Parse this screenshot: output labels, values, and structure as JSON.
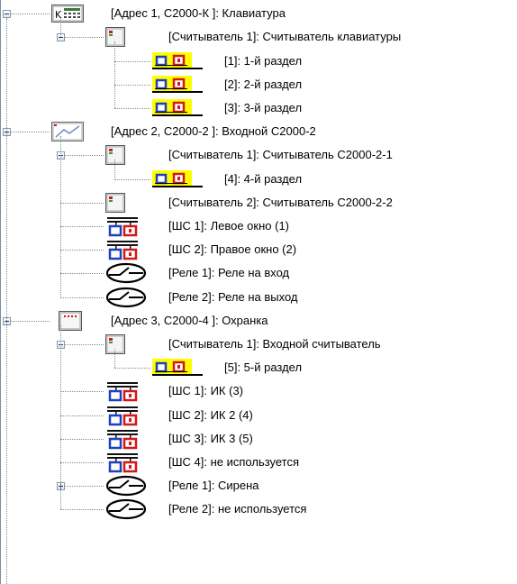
{
  "tree": [
    {
      "id": "n1",
      "label": "[Адрес 1, С2000-К ]: Клавиатура",
      "icon": "keypad-icon",
      "expander": "minus",
      "children": [
        {
          "id": "n1r1",
          "label": "[Считыватель 1]: Считыватель клавиатуры",
          "icon": "reader-icon",
          "expander": "minus",
          "children": [
            {
              "id": "n1r1a",
              "label": "[1]: 1-й раздел",
              "icon": "partition-icon"
            },
            {
              "id": "n1r1b",
              "label": "[2]: 2-й раздел",
              "icon": "partition-icon"
            },
            {
              "id": "n1r1c",
              "label": "[3]: 3-й раздел",
              "icon": "partition-icon"
            }
          ]
        }
      ]
    },
    {
      "id": "n2",
      "label": "[Адрес 2, С2000-2 ]: Входной С2000-2",
      "icon": "c2000-2-device-icon",
      "expander": "minus",
      "children": [
        {
          "id": "n2r1",
          "label": "[Считыватель 1]: Считыватель С2000-2-1",
          "icon": "reader-icon",
          "expander": "minus",
          "children": [
            {
              "id": "n2r1a",
              "label": "[4]: 4-й раздел",
              "icon": "partition-icon"
            }
          ]
        },
        {
          "id": "n2r2",
          "label": "[Считыватель 2]: Считыватель С2000-2-2",
          "icon": "reader-icon"
        },
        {
          "id": "n2z1",
          "label": "[ШС 1]: Левое окно (1)",
          "icon": "zone-icon"
        },
        {
          "id": "n2z2",
          "label": "[ШС 2]: Правое окно (2)",
          "icon": "zone-icon"
        },
        {
          "id": "n2p1",
          "label": "[Реле 1]: Реле на вход",
          "icon": "relay-icon"
        },
        {
          "id": "n2p2",
          "label": "[Реле 2]: Реле на выход",
          "icon": "relay-icon"
        }
      ]
    },
    {
      "id": "n3",
      "label": "[Адрес 3, С2000-4 ]: Охранка",
      "icon": "c2000-4-device-icon",
      "expander": "minus",
      "children": [
        {
          "id": "n3r1",
          "label": "[Считыватель 1]: Входной считыватель",
          "icon": "reader-icon",
          "expander": "minus",
          "children": [
            {
              "id": "n3r1a",
              "label": "[5]: 5-й раздел",
              "icon": "partition-icon"
            }
          ]
        },
        {
          "id": "n3z1",
          "label": "[ШС 1]: ИК (3)",
          "icon": "zone-icon"
        },
        {
          "id": "n3z2",
          "label": "[ШС 2]: ИК 2 (4)",
          "icon": "zone-icon"
        },
        {
          "id": "n3z3",
          "label": "[ШС 3]: ИК 3 (5)",
          "icon": "zone-icon"
        },
        {
          "id": "n3z4",
          "label": "[ШС 4]: не используется",
          "icon": "zone-icon"
        },
        {
          "id": "n3p1",
          "label": "[Реле 1]: Сирена",
          "icon": "relay-icon",
          "expander": "plus"
        },
        {
          "id": "n3p2",
          "label": "[Реле 2]: не используется",
          "icon": "relay-icon"
        }
      ]
    }
  ],
  "colors": {
    "connector": "#8a8a8a",
    "partition_bg": "#ffff00",
    "zone_blue": "#1f3fbf",
    "zone_red": "#d21818",
    "frame": "#7a8ea3"
  }
}
